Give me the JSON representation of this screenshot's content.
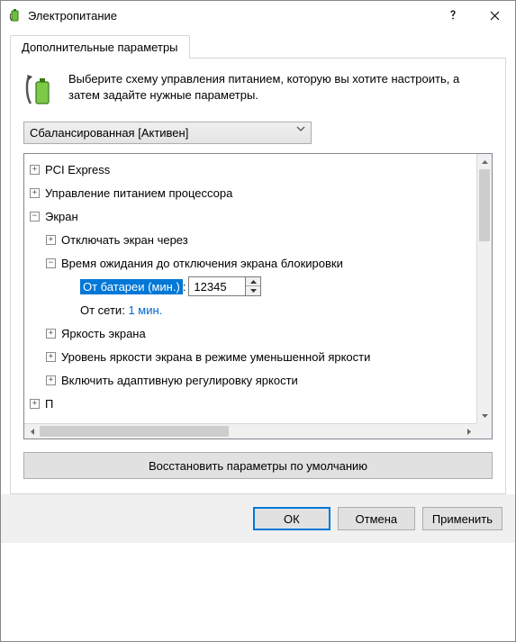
{
  "window": {
    "title": "Электропитание"
  },
  "tab": {
    "label": "Дополнительные параметры"
  },
  "intro": {
    "text": "Выберите схему управления питанием, которую вы хотите настроить, а затем задайте нужные параметры."
  },
  "combo": {
    "selected": "Сбалансированная [Активен]"
  },
  "tree": {
    "pci": "PCI Express",
    "cpu": "Управление питанием процессора",
    "screen": "Экран",
    "screen_off": "Отключать экран через",
    "lock_timeout": "Время ожидания до отключения экрана блокировки",
    "battery_label": "От батареи (мин.)",
    "colon": ":",
    "battery_value": "12345",
    "ac_label": "От сети:",
    "ac_value": "1 мин.",
    "brightness": "Яркость экрана",
    "dim_brightness": "Уровень яркости экрана в режиме уменьшенной яркости",
    "adaptive": "Включить адаптивную регулировку яркости",
    "cut": "П"
  },
  "buttons": {
    "restore": "Восстановить параметры по умолчанию",
    "ok": "ОК",
    "cancel": "Отмена",
    "apply": "Применить"
  }
}
